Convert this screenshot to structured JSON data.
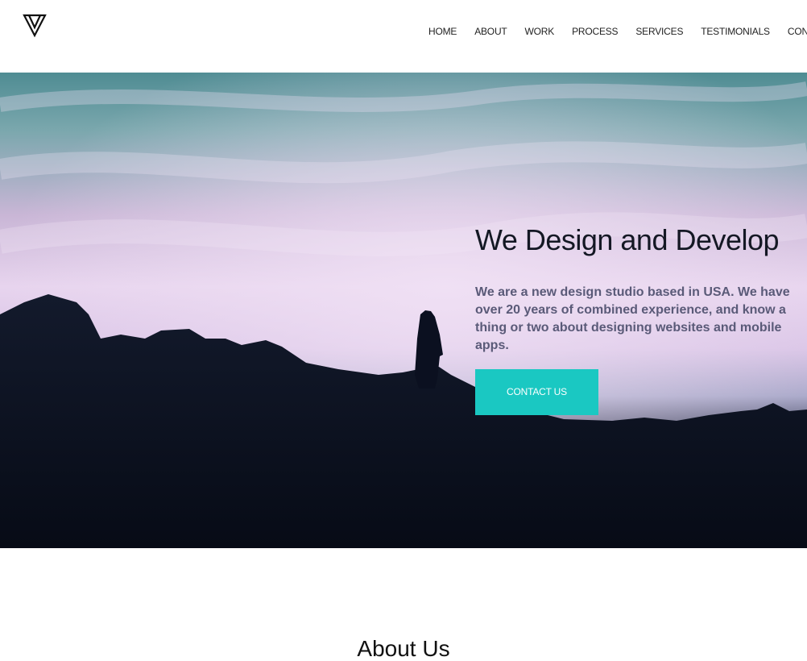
{
  "nav": {
    "items": [
      "HOME",
      "ABOUT",
      "WORK",
      "PROCESS",
      "SERVICES",
      "TESTIMONIALS",
      "CONTACT"
    ]
  },
  "hero": {
    "title": "We Design and Develop",
    "text": "We are a new design studio based in USA. We have over 20 years of combined experience, and know a thing or two about designing websites and mobile apps.",
    "cta_label": "CONTACT US"
  },
  "about": {
    "heading": "About Us"
  },
  "colors": {
    "accent": "#1ac8c2",
    "title": "#141824",
    "body_text": "#5a5a78"
  },
  "icons": {
    "logo": "triangle-logo-icon"
  }
}
